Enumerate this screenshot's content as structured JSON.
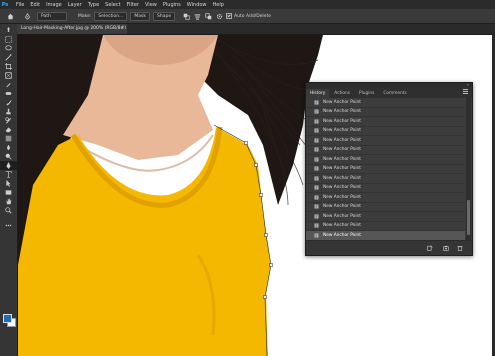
{
  "app": {
    "logo": "Ps"
  },
  "menu": [
    "File",
    "Edit",
    "Image",
    "Layer",
    "Type",
    "Select",
    "Filter",
    "View",
    "Plugins",
    "Window",
    "Help"
  ],
  "options": {
    "tool_mode": "Path",
    "make_label": "Make:",
    "selection_button": "Selection...",
    "mask_button": "Mask",
    "shape_button": "Shape",
    "auto_add_delete_label": "Auto Add/Delete"
  },
  "document": {
    "tab_title": "Long-Hair-Masking-After.jpg @ 200% (RGB/8#) *",
    "close_glyph": "×"
  },
  "tools": [
    "move-icon",
    "marquee-icon",
    "lasso-icon",
    "magic-wand-icon",
    "crop-icon",
    "frame-icon",
    "eyedropper-icon",
    "healing-icon",
    "brush-icon",
    "clone-stamp-icon",
    "history-brush-icon",
    "eraser-icon",
    "gradient-icon",
    "blur-icon",
    "dodge-icon",
    "pen-icon",
    "type-icon",
    "path-select-icon",
    "rectangle-icon",
    "hand-icon",
    "zoom-icon",
    "more-tools-icon"
  ],
  "colors": {
    "foreground": "#1a6fb5",
    "background": "#ffffff",
    "shirt": "#f5b800",
    "skin": "#e8b898",
    "hair": "#1e1713"
  },
  "history_panel": {
    "collapse_glyph": "«",
    "tabs": [
      "History",
      "Actions",
      "Plugins",
      "Comments"
    ],
    "active_tab": 0,
    "items": [
      "New Anchor Point",
      "New Anchor Point",
      "New Anchor Point",
      "New Anchor Point",
      "New Anchor Point",
      "New Anchor Point",
      "New Anchor Point",
      "New Anchor Point",
      "New Anchor Point",
      "New Anchor Point",
      "New Anchor Point",
      "New Anchor Point",
      "New Anchor Point",
      "New Anchor Point",
      "New Anchor Point"
    ],
    "active_index": 14,
    "footer_buttons": [
      "new-snapshot-doc-icon",
      "camera-icon",
      "trash-icon"
    ]
  }
}
